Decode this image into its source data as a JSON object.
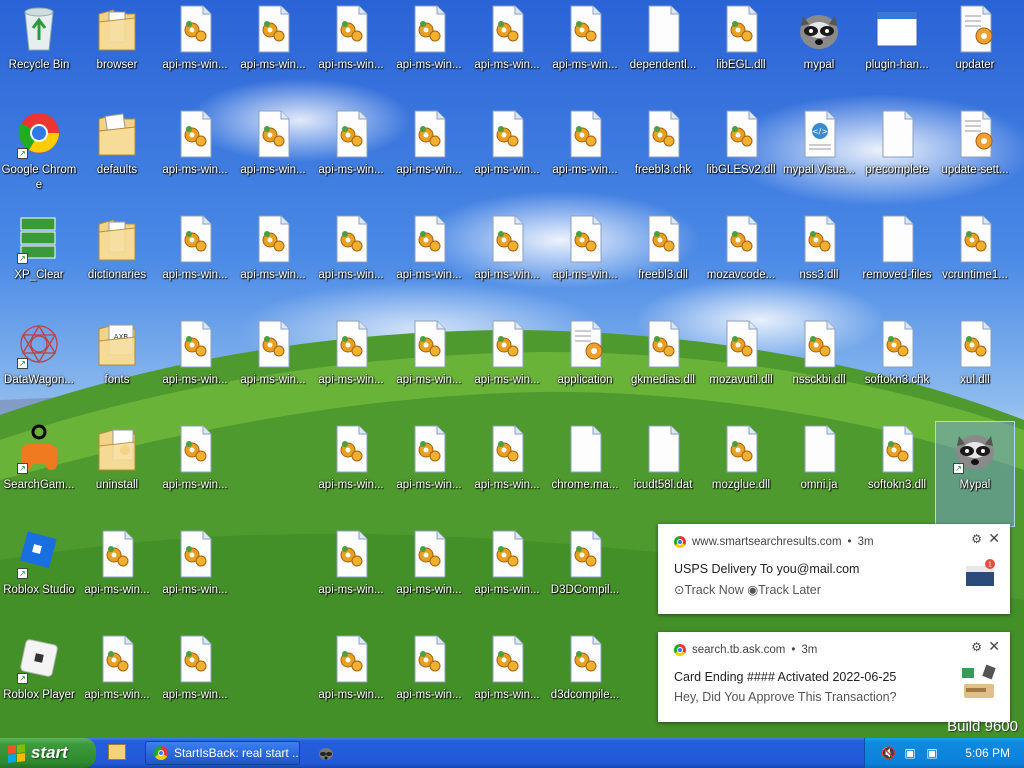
{
  "desktop": {
    "build_text": "Build 9600",
    "icons": [
      {
        "label": "Recycle Bin",
        "type": "recycle"
      },
      {
        "label": "browser",
        "type": "folder"
      },
      {
        "label": "api-ms-win...",
        "type": "dll"
      },
      {
        "label": "api-ms-win...",
        "type": "dll"
      },
      {
        "label": "api-ms-win...",
        "type": "dll"
      },
      {
        "label": "api-ms-win...",
        "type": "dll"
      },
      {
        "label": "api-ms-win...",
        "type": "dll"
      },
      {
        "label": "api-ms-win...",
        "type": "dll"
      },
      {
        "label": "dependentl...",
        "type": "blank"
      },
      {
        "label": "libEGL.dll",
        "type": "dll"
      },
      {
        "label": "mypal",
        "type": "raccoon"
      },
      {
        "label": "plugin-han...",
        "type": "window"
      },
      {
        "label": "updater",
        "type": "config"
      },
      {
        "label": "Google Chrome",
        "type": "chrome"
      },
      {
        "label": "defaults",
        "type": "folder-open"
      },
      {
        "label": "api-ms-win...",
        "type": "dll"
      },
      {
        "label": "api-ms-win...",
        "type": "dll"
      },
      {
        "label": "api-ms-win...",
        "type": "dll"
      },
      {
        "label": "api-ms-win...",
        "type": "dll"
      },
      {
        "label": "api-ms-win...",
        "type": "dll"
      },
      {
        "label": "api-ms-win...",
        "type": "dll"
      },
      {
        "label": "freebl3.chk",
        "type": "dll"
      },
      {
        "label": "libGLESv2.dll",
        "type": "dll"
      },
      {
        "label": "mypal.Visua...",
        "type": "manifest"
      },
      {
        "label": "precomplete",
        "type": "blank"
      },
      {
        "label": "update-sett...",
        "type": "config"
      },
      {
        "label": "XP_Clear",
        "type": "xpclear"
      },
      {
        "label": "dictionaries",
        "type": "folder"
      },
      {
        "label": "api-ms-win...",
        "type": "dll"
      },
      {
        "label": "api-ms-win...",
        "type": "dll"
      },
      {
        "label": "api-ms-win...",
        "type": "dll"
      },
      {
        "label": "api-ms-win...",
        "type": "dll"
      },
      {
        "label": "api-ms-win...",
        "type": "dll"
      },
      {
        "label": "api-ms-win...",
        "type": "dll"
      },
      {
        "label": "freebl3.dll",
        "type": "dll"
      },
      {
        "label": "mozavcode...",
        "type": "dll"
      },
      {
        "label": "nss3.dll",
        "type": "dll"
      },
      {
        "label": "removed-files",
        "type": "blank"
      },
      {
        "label": "vcruntime1...",
        "type": "dll"
      },
      {
        "label": "DataWagon...",
        "type": "datawagon"
      },
      {
        "label": "fonts",
        "type": "folder-doc"
      },
      {
        "label": "api-ms-win...",
        "type": "dll"
      },
      {
        "label": "api-ms-win...",
        "type": "dll"
      },
      {
        "label": "api-ms-win...",
        "type": "dll"
      },
      {
        "label": "api-ms-win...",
        "type": "dll"
      },
      {
        "label": "api-ms-win...",
        "type": "dll"
      },
      {
        "label": "application",
        "type": "config"
      },
      {
        "label": "gkmedias.dll",
        "type": "dll"
      },
      {
        "label": "mozavutil.dll",
        "type": "dll"
      },
      {
        "label": "nssckbi.dll",
        "type": "dll"
      },
      {
        "label": "softokn3.chk",
        "type": "dll"
      },
      {
        "label": "xul.dll",
        "type": "dll"
      },
      {
        "label": "SearchGam...",
        "type": "gamepad"
      },
      {
        "label": "uninstall",
        "type": "folder-dll"
      },
      {
        "label": "api-ms-win...",
        "type": "dll"
      },
      {
        "label": "api-ms-win...",
        "type": "dll"
      },
      {
        "label": "api-ms-win...",
        "type": "dll"
      },
      {
        "label": "api-ms-win...",
        "type": "dll"
      },
      {
        "label": "chrome.ma...",
        "type": "blank"
      },
      {
        "label": "icudt58l.dat",
        "type": "blank"
      },
      {
        "label": "mozglue.dll",
        "type": "dll"
      },
      {
        "label": "omni.ja",
        "type": "blank"
      },
      {
        "label": "softokn3.dll",
        "type": "dll"
      },
      {
        "label": "Mypal",
        "type": "raccoon-selected"
      },
      {
        "label": "Roblox Studio",
        "type": "roblox-studio"
      },
      {
        "label": "api-ms-win...",
        "type": "dll"
      },
      {
        "label": "api-ms-win...",
        "type": "dll"
      },
      {
        "label": "api-ms-win...",
        "type": "dll"
      },
      {
        "label": "api-ms-win...",
        "type": "dll"
      },
      {
        "label": "api-ms-win...",
        "type": "dll"
      },
      {
        "label": "D3DCompil...",
        "type": "dll"
      },
      {
        "label": "Roblox Player",
        "type": "roblox-player"
      },
      {
        "label": "api-ms-win...",
        "type": "dll"
      },
      {
        "label": "api-ms-win...",
        "type": "dll"
      },
      {
        "label": "api-ms-win...",
        "type": "dll"
      },
      {
        "label": "api-ms-win...",
        "type": "dll"
      },
      {
        "label": "api-ms-win...",
        "type": "dll"
      },
      {
        "label": "d3dcompile...",
        "type": "dll"
      }
    ]
  },
  "notifications": [
    {
      "source": "www.smartsearchresults.com",
      "age": "3m",
      "title": "USPS Delivery To you@mail.com",
      "line2": "⊙Track Now  ◉Track Later",
      "image": "package-icon"
    },
    {
      "source": "search.tb.ask.com",
      "age": "3m",
      "title": "Card Ending #### Activated 2022-06-25",
      "line2": "Hey, Did You Approve This Transaction?",
      "image": "payment-icon"
    }
  ],
  "taskbar": {
    "start_label": "start",
    "task_button_label": "StartIsBack: real start ...",
    "clock": "5:06 PM",
    "tray_icons": [
      "volume-muted-icon",
      "network-icon",
      "network-warning-icon"
    ]
  },
  "colors": {
    "taskbar": "#245edc",
    "start_button": "#3c9b3c",
    "tray": "#0f8ae0"
  }
}
